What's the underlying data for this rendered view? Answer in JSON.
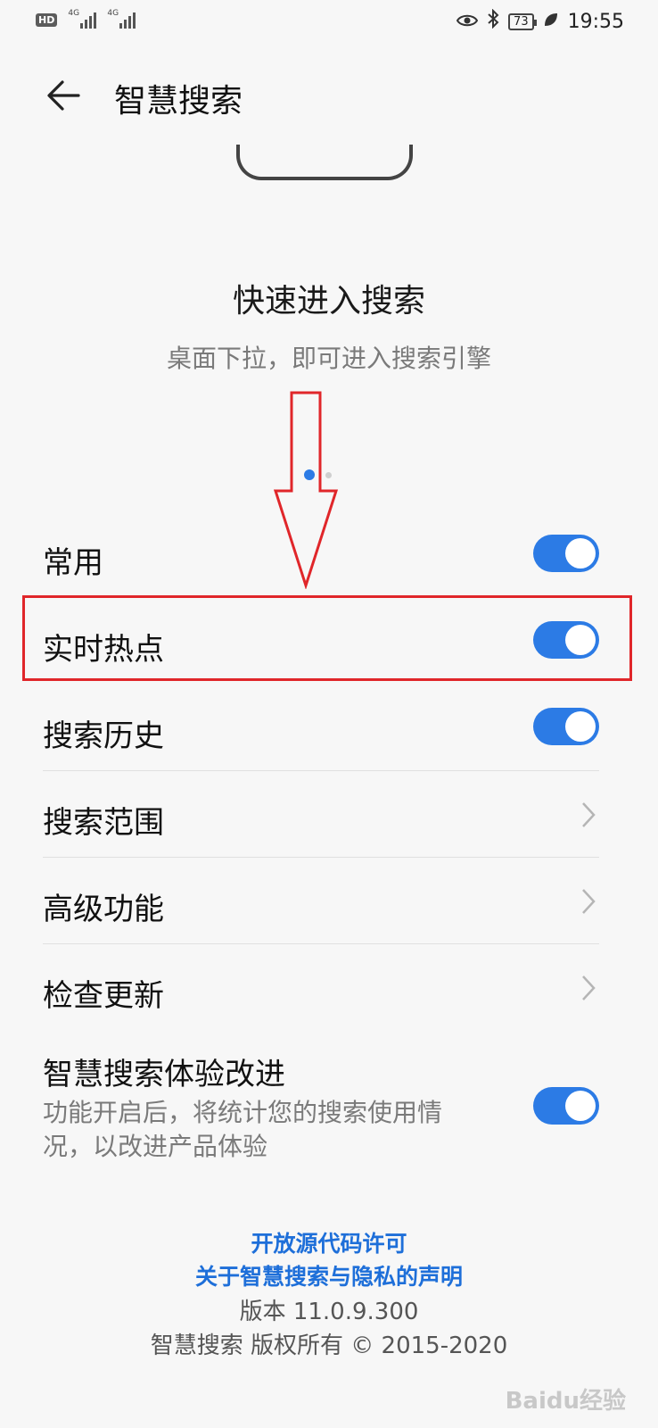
{
  "status_bar": {
    "hd_label": "HD",
    "network_1": "4G",
    "network_2": "4G",
    "battery": "73",
    "time": "19:55"
  },
  "app_bar": {
    "title": "智慧搜索"
  },
  "hero": {
    "headline": "快速进入搜索",
    "subtitle": "桌面下拉，即可进入搜索引擎",
    "page_indicator": {
      "current": 1,
      "total": 2
    }
  },
  "settings": [
    {
      "label": "常用",
      "type": "toggle",
      "on": true
    },
    {
      "label": "实时热点",
      "type": "toggle",
      "on": true
    },
    {
      "label": "搜索历史",
      "type": "toggle",
      "on": true
    },
    {
      "label": "搜索范围",
      "type": "link"
    },
    {
      "label": "高级功能",
      "type": "link"
    },
    {
      "label": "检查更新",
      "type": "link"
    }
  ],
  "experience": {
    "title": "智慧搜索体验改进",
    "description": "功能开启后，将统计您的搜索使用情况，以改进产品体验",
    "on": true
  },
  "footer": {
    "open_source": "开放源代码许可",
    "privacy": "关于智慧搜索与隐私的声明",
    "version": "版本 11.0.9.300",
    "copyright": "智慧搜索 版权所有 © 2015-2020"
  },
  "watermark": "Baidu经验",
  "colors": {
    "accent": "#2c7be5",
    "annotation": "#e0262a",
    "link": "#1e6fd9"
  }
}
